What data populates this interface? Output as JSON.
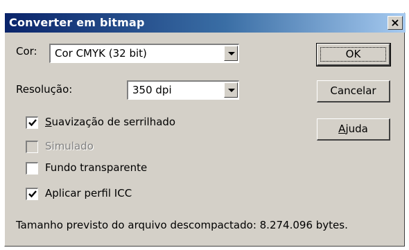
{
  "window": {
    "title": "Converter em bitmap",
    "close_glyph": "×"
  },
  "fields": {
    "color_label": "Cor:",
    "color_value": "Cor CMYK (32 bit)",
    "resolution_label": "Resolução:",
    "resolution_value": "350 dpi"
  },
  "buttons": {
    "ok": "OK",
    "cancel": "Cancelar",
    "help_first": "A",
    "help_rest": "juda"
  },
  "options": {
    "antialias": {
      "first": "S",
      "rest": "uavização de serrilhado",
      "checked": true,
      "enabled": true
    },
    "simulated": {
      "label": "Simulado",
      "checked": false,
      "enabled": false
    },
    "transparent": {
      "label": "Fundo transparente",
      "checked": false,
      "enabled": true
    },
    "icc": {
      "label": "Aplicar perfil ICC",
      "checked": true,
      "enabled": true
    }
  },
  "status": {
    "text": "Tamanho previsto do arquivo descompactado: 8.274.096 bytes."
  },
  "colors": {
    "title_gradient_start": "#0a246a",
    "title_gradient_end": "#a6caf0",
    "dialog_face": "#d4d0c8"
  },
  "icons": {
    "close": "close-icon",
    "dropdown": "chevron-down-icon",
    "check": "check-icon"
  }
}
